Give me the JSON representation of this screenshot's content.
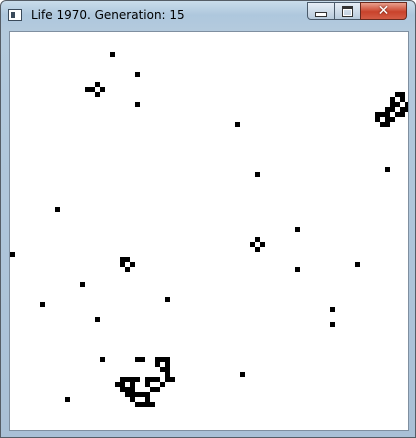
{
  "window": {
    "title": "Life 1970. Generation: 15",
    "controls": [
      "minimize-icon",
      "maximize-icon",
      "close-icon"
    ]
  },
  "board": {
    "cell_color": "#000000",
    "background": "#ffffff",
    "cells": [
      [
        20,
        3
      ],
      [
        25,
        7
      ],
      [
        15,
        10
      ],
      [
        25,
        13
      ],
      [
        45,
        17
      ],
      [
        75,
        26
      ],
      [
        49,
        27
      ],
      [
        9,
        34
      ],
      [
        57,
        38
      ],
      [
        0,
        43
      ],
      [
        69,
        45
      ],
      [
        57,
        46
      ],
      [
        14,
        49
      ],
      [
        31,
        52
      ],
      [
        6,
        53
      ],
      [
        64,
        54
      ],
      [
        64,
        57
      ],
      [
        17,
        56
      ],
      [
        18,
        64
      ],
      [
        46,
        67
      ],
      [
        11,
        72
      ],
      [
        17,
        9
      ],
      [
        16,
        10
      ],
      [
        18,
        10
      ],
      [
        17,
        11
      ],
      [
        49,
        40
      ],
      [
        48,
        41
      ],
      [
        50,
        41
      ],
      [
        49,
        42
      ],
      [
        22,
        44
      ],
      [
        23,
        44
      ],
      [
        22,
        45
      ],
      [
        24,
        45
      ],
      [
        23,
        46
      ],
      [
        77,
        11
      ],
      [
        78,
        11
      ],
      [
        76,
        12
      ],
      [
        78,
        12
      ],
      [
        76,
        13
      ],
      [
        77,
        13
      ],
      [
        79,
        13
      ],
      [
        80,
        13
      ],
      [
        75,
        14
      ],
      [
        76,
        14
      ],
      [
        78,
        14
      ],
      [
        79,
        14
      ],
      [
        80,
        14
      ],
      [
        73,
        15
      ],
      [
        74,
        15
      ],
      [
        75,
        15
      ],
      [
        77,
        15
      ],
      [
        78,
        15
      ],
      [
        73,
        16
      ],
      [
        75,
        16
      ],
      [
        76,
        16
      ],
      [
        74,
        17
      ],
      [
        75,
        17
      ],
      [
        25,
        64
      ],
      [
        26,
        64
      ],
      [
        29,
        64
      ],
      [
        30,
        64
      ],
      [
        31,
        64
      ],
      [
        29,
        65
      ],
      [
        31,
        65
      ],
      [
        30,
        66
      ],
      [
        31,
        66
      ],
      [
        31,
        67
      ],
      [
        22,
        68
      ],
      [
        23,
        68
      ],
      [
        24,
        68
      ],
      [
        25,
        68
      ],
      [
        27,
        68
      ],
      [
        28,
        68
      ],
      [
        29,
        68
      ],
      [
        31,
        68
      ],
      [
        32,
        68
      ],
      [
        21,
        69
      ],
      [
        22,
        69
      ],
      [
        24,
        69
      ],
      [
        27,
        69
      ],
      [
        30,
        69
      ],
      [
        22,
        70
      ],
      [
        23,
        70
      ],
      [
        24,
        70
      ],
      [
        28,
        70
      ],
      [
        29,
        70
      ],
      [
        23,
        71
      ],
      [
        24,
        71
      ],
      [
        25,
        71
      ],
      [
        26,
        71
      ],
      [
        27,
        71
      ],
      [
        24,
        72
      ],
      [
        27,
        72
      ],
      [
        25,
        73
      ],
      [
        26,
        73
      ],
      [
        27,
        73
      ],
      [
        28,
        73
      ]
    ]
  }
}
